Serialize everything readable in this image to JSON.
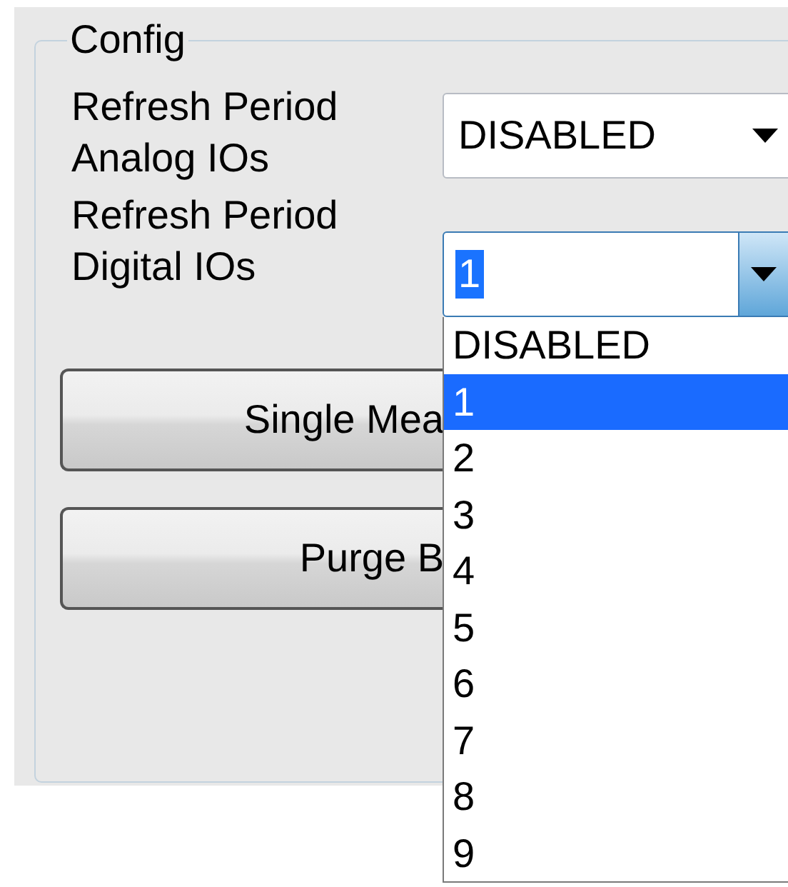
{
  "group": {
    "title": "Config"
  },
  "fields": [
    {
      "label": "Refresh Period Analog IOs",
      "value": "DISABLED",
      "focused": false,
      "open": false
    },
    {
      "label": "Refresh Period Digital IOs",
      "value": "1",
      "focused": true,
      "open": true,
      "options": [
        {
          "label": "DISABLED",
          "selected": false
        },
        {
          "label": "1",
          "selected": true
        },
        {
          "label": "2",
          "selected": false
        },
        {
          "label": "3",
          "selected": false
        },
        {
          "label": "4",
          "selected": false
        },
        {
          "label": "5",
          "selected": false
        },
        {
          "label": "6",
          "selected": false
        },
        {
          "label": "7",
          "selected": false
        },
        {
          "label": "8",
          "selected": false
        },
        {
          "label": "9",
          "selected": false
        }
      ]
    }
  ],
  "buttons": [
    "Single Mea",
    "Purge B"
  ]
}
